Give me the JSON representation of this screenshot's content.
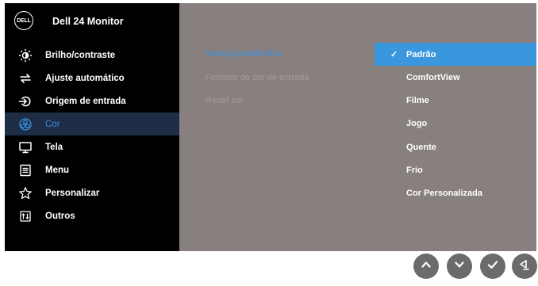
{
  "header": {
    "logo_text": "DELL",
    "title": "Dell 24 Monitor"
  },
  "menu": [
    {
      "label": "Brilho/contraste",
      "icon": "brightness-icon",
      "active": false
    },
    {
      "label": "Ajuste automático",
      "icon": "auto-adjust-icon",
      "active": false
    },
    {
      "label": "Origem de entrada",
      "icon": "input-source-icon",
      "active": false
    },
    {
      "label": "Cor",
      "icon": "color-icon",
      "active": true
    },
    {
      "label": "Tela",
      "icon": "display-icon",
      "active": false
    },
    {
      "label": "Menu",
      "icon": "menu-icon",
      "active": false
    },
    {
      "label": "Personalizar",
      "icon": "star-icon",
      "active": false
    },
    {
      "label": "Outros",
      "icon": "others-icon",
      "active": false
    }
  ],
  "submenu": [
    {
      "label": "Modos predefinidos",
      "active": true
    },
    {
      "label": "Formato de cor de entrada",
      "active": false
    },
    {
      "label": "Redef cor",
      "active": false
    }
  ],
  "options": [
    {
      "label": "Padrão",
      "selected": true,
      "check": "✓"
    },
    {
      "label": "ComfortView",
      "selected": false
    },
    {
      "label": "Filme",
      "selected": false
    },
    {
      "label": "Jogo",
      "selected": false
    },
    {
      "label": "Quente",
      "selected": false
    },
    {
      "label": "Frio",
      "selected": false
    },
    {
      "label": "Cor Personalizada",
      "selected": false
    }
  ],
  "buttons": [
    {
      "icon": "up-arrow-icon"
    },
    {
      "icon": "down-arrow-icon"
    },
    {
      "icon": "check-icon"
    },
    {
      "icon": "back-icon"
    }
  ],
  "colors": {
    "accent": "#3a96dd",
    "panel": "#87807e",
    "sidebar": "#000000",
    "active_text": "#3a8fe0"
  }
}
